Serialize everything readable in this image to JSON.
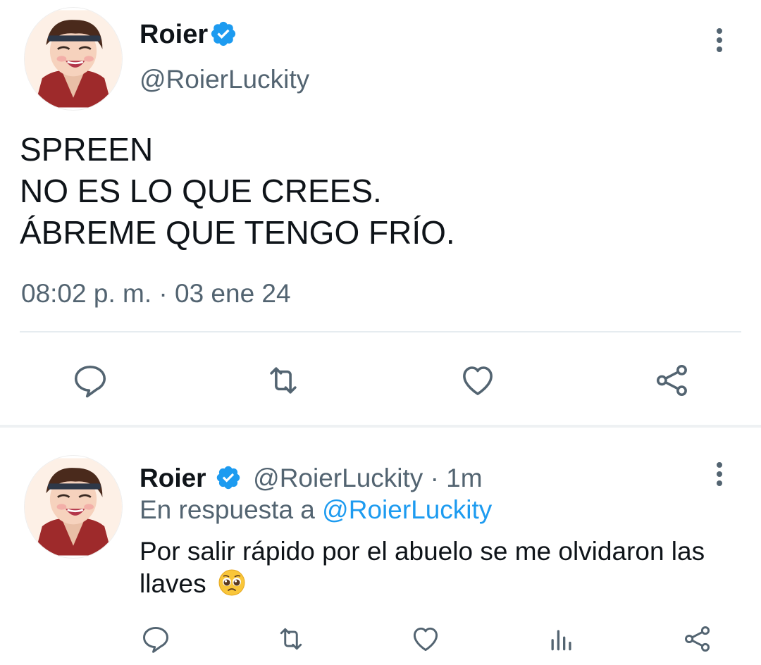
{
  "main_tweet": {
    "author_name": "Roier",
    "author_handle": "@RoierLuckity",
    "text_lines": [
      "SPREEN",
      "NO ES LO QUE CREES.",
      "ÁBREME QUE TENGO FRÍO."
    ],
    "timestamp": "08:02 p. m. · 03 ene 24",
    "actions": [
      "reply-icon",
      "retweet-icon",
      "like-icon",
      "share-icon"
    ]
  },
  "reply_tweet": {
    "author_name": "Roier",
    "author_handle": "@RoierLuckity",
    "age": "· 1m",
    "in_reply_prefix": "En respuesta a",
    "in_reply_handle": "@RoierLuckity",
    "text": "Por salir rápido por el abuelo se me olvidaron las llaves",
    "emoji": "pleading-face-emoji",
    "actions": [
      "reply-icon",
      "retweet-icon",
      "like-icon",
      "analytics-icon",
      "share-icon"
    ]
  },
  "colors": {
    "verified": "#1d9bf0",
    "secondary_text": "#536471",
    "icon": "#536471",
    "mention": "#1d9bf0"
  }
}
